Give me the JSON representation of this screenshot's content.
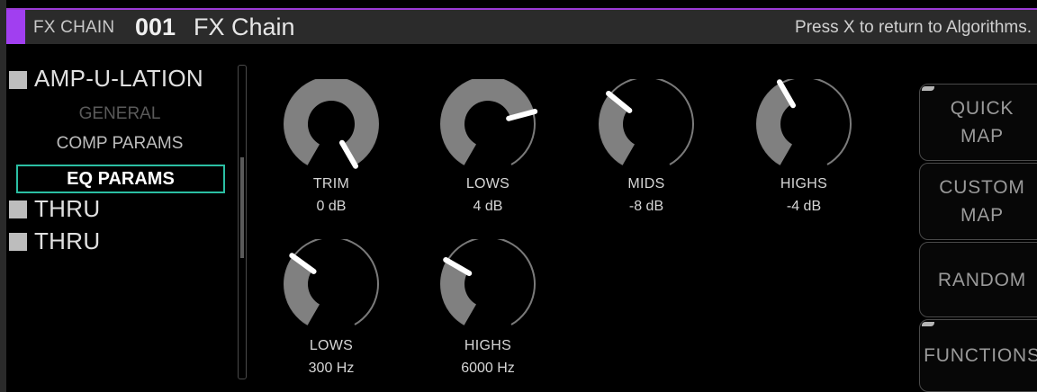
{
  "header": {
    "kind": "FX CHAIN",
    "number": "001",
    "name": "FX Chain",
    "hint": "Press X to return to Algorithms."
  },
  "nav": {
    "effect_1": "AMP-U-LATION",
    "pages": {
      "general": "GENERAL",
      "comp": "COMP PARAMS",
      "eq": "EQ PARAMS"
    },
    "effect_2": "THRU",
    "effect_3": "THRU"
  },
  "knobs": {
    "trim": {
      "label": "TRIM",
      "value": "0 dB"
    },
    "lows": {
      "label": "LOWS",
      "value": "4 dB"
    },
    "mids": {
      "label": "MIDS",
      "value": "-8 dB"
    },
    "highs": {
      "label": "HIGHS",
      "value": "-4 dB"
    },
    "lows_freq": {
      "label": "LOWS",
      "value": "300 Hz"
    },
    "highs_freq": {
      "label": "HIGHS",
      "value": "6000 Hz"
    }
  },
  "knob_levels": {
    "trim": 1.0,
    "lows": 0.75,
    "mids": 0.33,
    "highs": 0.4,
    "lows_freq": 0.32,
    "highs_freq": 0.3
  },
  "buttons": {
    "quick_map": "QUICK\nMAP",
    "custom_map": "CUSTOM\nMAP",
    "random": "RANDOM",
    "functions": "FUNCTIONS"
  },
  "colors": {
    "accent": "#a13ff0",
    "selection": "#2bbfa3",
    "knob_fill": "#808080"
  }
}
